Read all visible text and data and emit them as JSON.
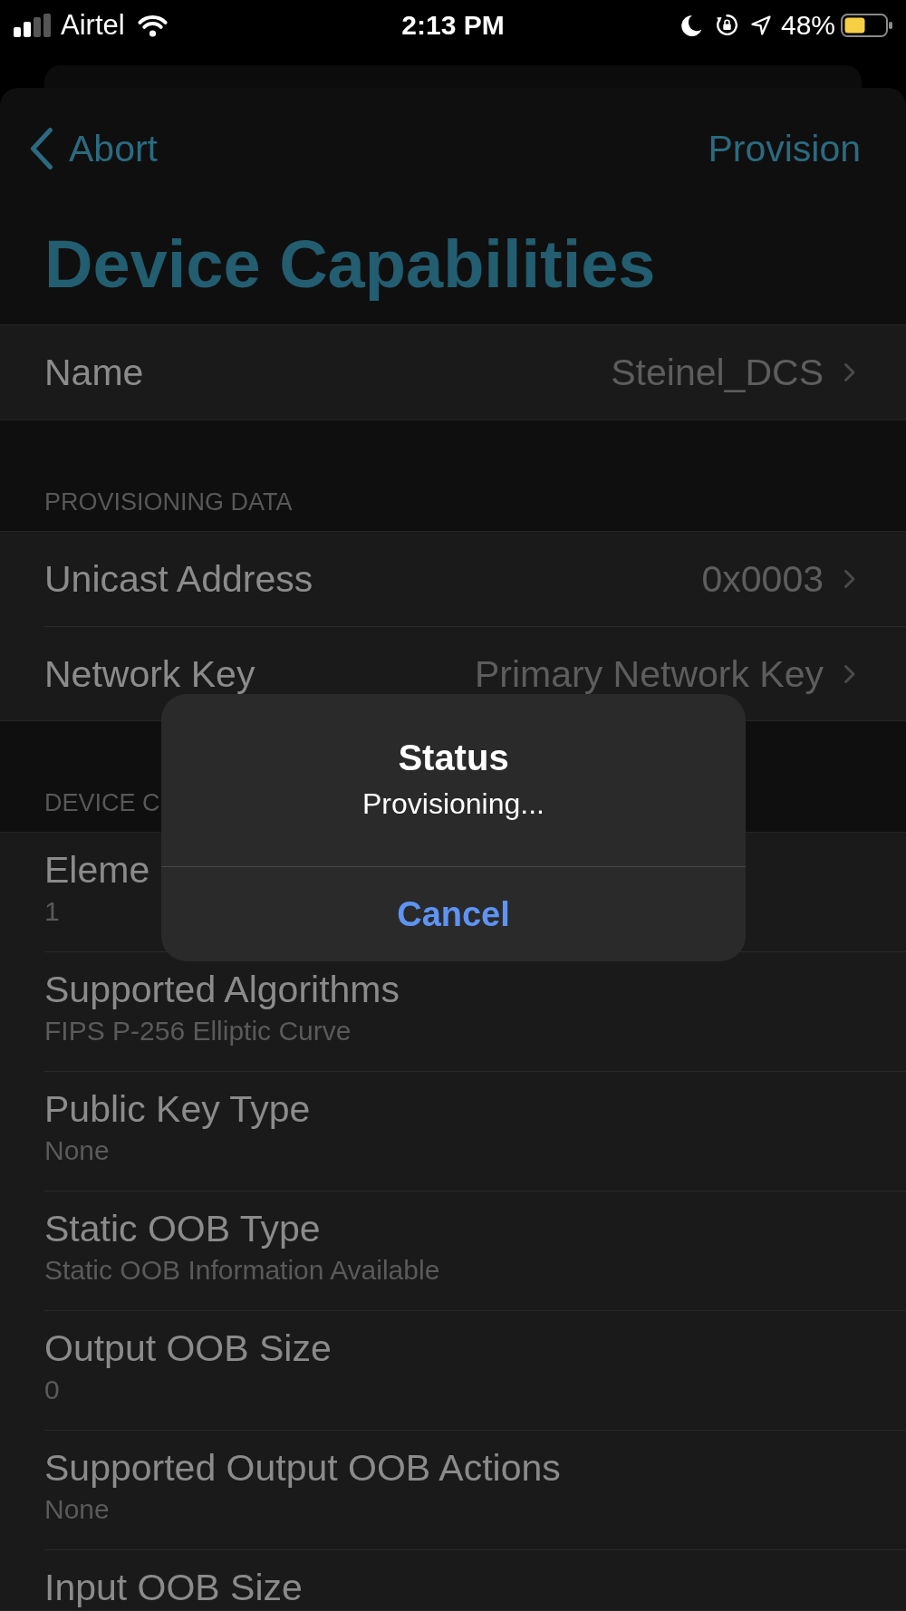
{
  "status_bar": {
    "carrier": "Airtel",
    "time": "2:13 PM",
    "battery": "48%"
  },
  "navigation": {
    "back": "Abort",
    "action": "Provision",
    "title": "Device Capabilities"
  },
  "sections": [
    {
      "rows": [
        {
          "kind": "value",
          "label": "Name",
          "value": "Steinel_DCS"
        }
      ]
    },
    {
      "header": "PROVISIONING DATA",
      "rows": [
        {
          "kind": "value",
          "label": "Unicast Address",
          "value": "0x0003"
        },
        {
          "kind": "value",
          "label": "Network Key",
          "value": "Primary Network Key"
        }
      ]
    },
    {
      "header": "DEVICE C",
      "rows": [
        {
          "kind": "detail",
          "label": "Eleme",
          "detail": "1"
        },
        {
          "kind": "detail",
          "label": "Supported Algorithms",
          "detail": "FIPS P-256 Elliptic Curve"
        },
        {
          "kind": "detail",
          "label": "Public Key Type",
          "detail": "None"
        },
        {
          "kind": "detail",
          "label": "Static OOB Type",
          "detail": "Static OOB Information Available"
        },
        {
          "kind": "detail",
          "label": "Output OOB Size",
          "detail": "0"
        },
        {
          "kind": "detail",
          "label": "Supported Output OOB Actions",
          "detail": "None"
        },
        {
          "kind": "detail",
          "label": "Input OOB Size"
        }
      ]
    }
  ],
  "alert": {
    "title": "Status",
    "message": "Provisioning...",
    "buttons": [
      "Cancel"
    ]
  }
}
